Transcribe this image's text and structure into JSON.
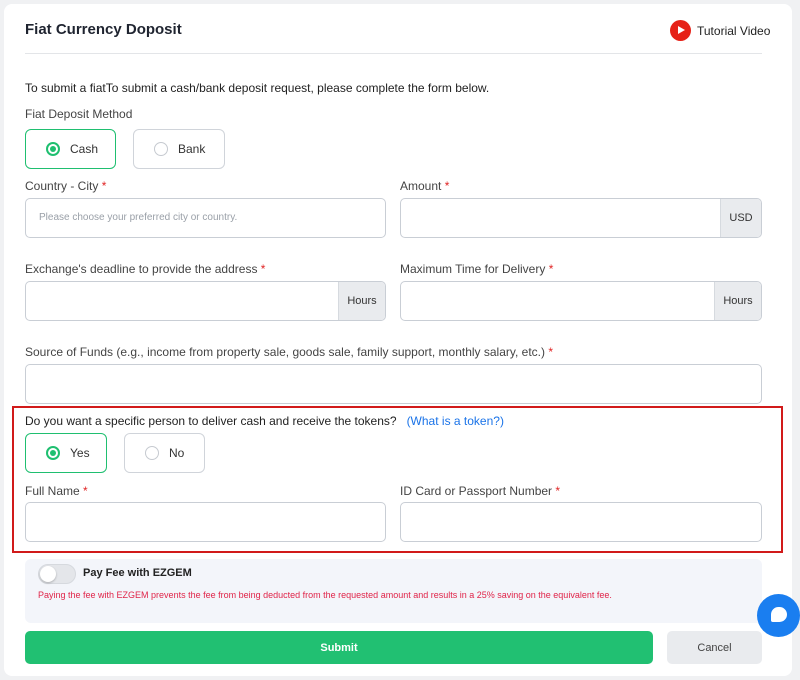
{
  "header": {
    "title": "Fiat Currency Doposit",
    "tutorial_label": "Tutorial Video",
    "tutorial_icon": "youtube-play-icon"
  },
  "intro": "To submit a fiatTo submit a cash/bank deposit request, please complete the form below.",
  "method": {
    "label": "Fiat Deposit Method",
    "options": [
      "Cash",
      "Bank"
    ],
    "selected": "Cash"
  },
  "fields": {
    "country_city": {
      "label": "Country - City",
      "placeholder": "Please choose your preferred city or country.",
      "value": ""
    },
    "amount": {
      "label": "Amount",
      "suffix": "USD",
      "value": ""
    },
    "exchange_deadline": {
      "label": "Exchange's deadline to provide the address",
      "suffix": "Hours",
      "value": ""
    },
    "max_delivery": {
      "label": "Maximum Time for Delivery",
      "suffix": "Hours",
      "value": ""
    },
    "source_of_funds": {
      "label": "Source of Funds (e.g., income from property sale, goods sale, family support, monthly salary, etc.)",
      "value": ""
    },
    "full_name": {
      "label": "Full Name",
      "value": ""
    },
    "id_card": {
      "label": "ID Card or Passport Number",
      "value": ""
    }
  },
  "required_marker": "*",
  "specific_person": {
    "question": "Do you want a specific person to deliver cash and receive the tokens?",
    "link_text": "(What is a token?)",
    "options": [
      "Yes",
      "No"
    ],
    "selected": "Yes"
  },
  "fee": {
    "toggle_label": "Pay Fee with EZGEM",
    "enabled": false,
    "note": "Paying the fee with EZGEM prevents the fee from being deducted from the requested amount and results in a 25% saving on the equivalent fee."
  },
  "actions": {
    "submit": "Submit",
    "cancel": "Cancel"
  },
  "colors": {
    "accent": "#21c072",
    "required": "#e02424",
    "highlight": "#d11a1a",
    "link": "#1a73e8",
    "chat": "#1a7ef0"
  }
}
